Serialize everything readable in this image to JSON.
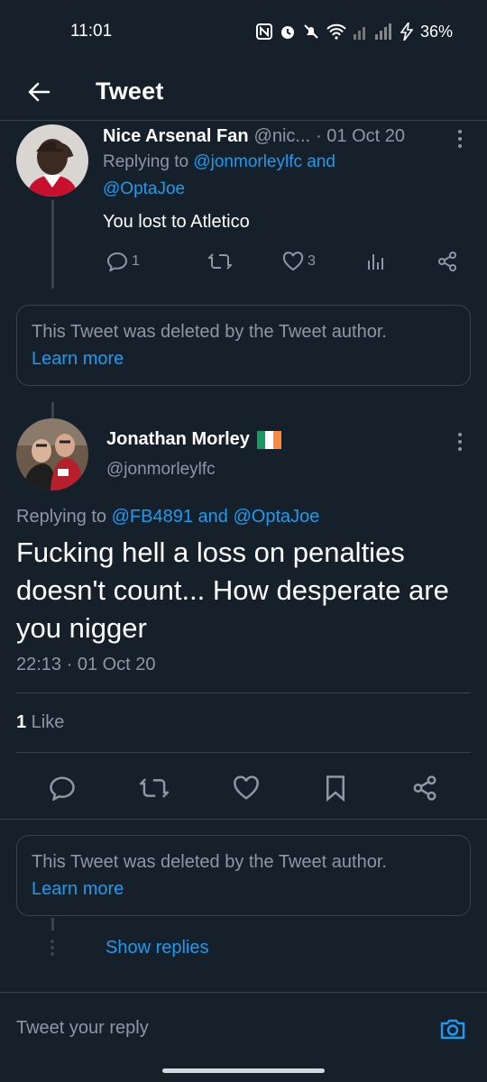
{
  "status_bar": {
    "time": "11:01",
    "battery": "36%",
    "icons": [
      "nfc-icon",
      "alarm-icon",
      "mute-icon",
      "wifi-icon",
      "signal-icon",
      "battery-charging-icon"
    ]
  },
  "header": {
    "title": "Tweet",
    "back_icon": "arrow-left-icon"
  },
  "reply_tweet": {
    "name": "Nice Arsenal Fan",
    "handle": "@nic...",
    "date": "· 01 Oct 20",
    "replying_prefix": "Replying to ",
    "replying_user1": "@jonmorleylfc",
    "replying_and": " and",
    "replying_user2": "@OptaJoe",
    "text": "You lost to Atletico",
    "reply_count": "1",
    "retweet_count": "",
    "like_count": "3"
  },
  "deleted_notice_1": {
    "text": "This Tweet was deleted by the Tweet author.",
    "link": "Learn more"
  },
  "main_tweet": {
    "name": "Jonathan Morley",
    "flag": "ireland-flag",
    "handle": "@jonmorleylfc",
    "replying_prefix": "Replying to ",
    "replying_user1": "@FB4891",
    "replying_and": " and ",
    "replying_user2": "@OptaJoe",
    "text": "Fucking hell a loss on penalties doesn't count... How desperate are you nigger",
    "time": "22:13 · 01 Oct 20",
    "likes_count": "1",
    "likes_label": " Like"
  },
  "deleted_notice_2": {
    "text": "This Tweet was deleted by the Tweet author.",
    "link": "Learn more"
  },
  "show_replies": "Show replies",
  "reply_bar": {
    "placeholder": "Tweet your reply",
    "icon": "camera-icon"
  },
  "colors": {
    "background": "#15202b",
    "accent": "#1d9bf0",
    "muted": "#8b98a5",
    "border": "#38444d"
  }
}
